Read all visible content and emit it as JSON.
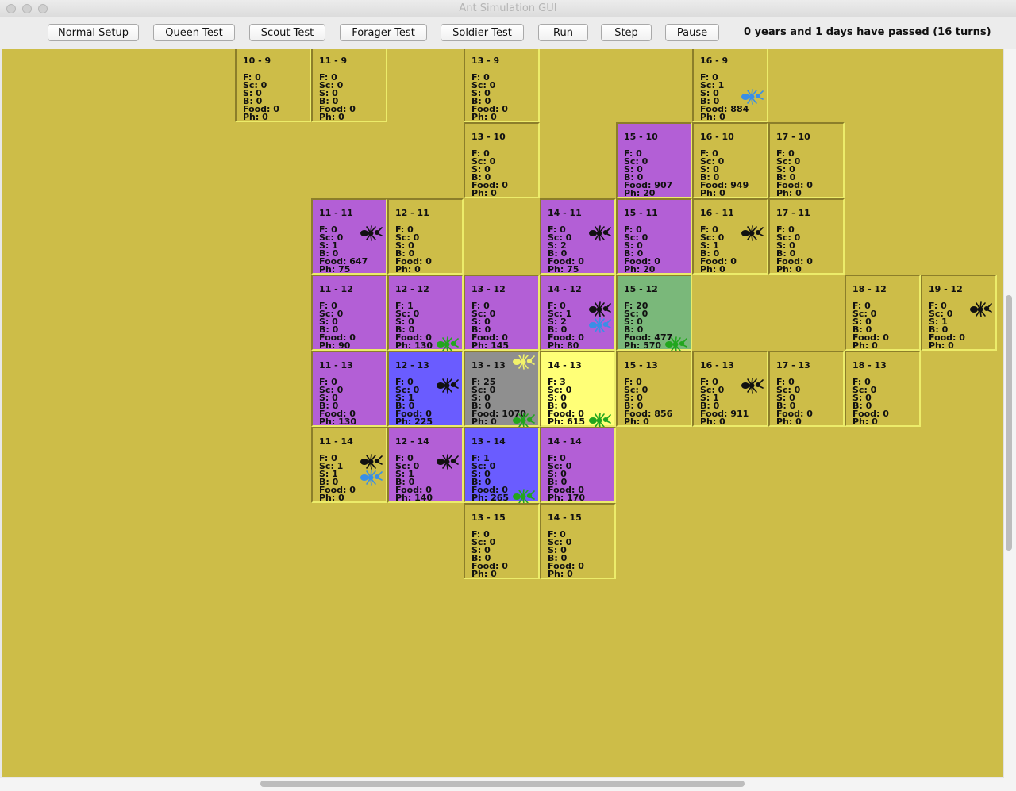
{
  "window": {
    "title": "Ant Simulation GUI"
  },
  "toolbar": {
    "buttons": [
      {
        "id": "normal-setup",
        "label": "Normal Setup"
      },
      {
        "id": "queen-test",
        "label": "Queen Test"
      },
      {
        "id": "scout-test",
        "label": "Scout Test"
      },
      {
        "id": "forager-test",
        "label": "Forager Test"
      },
      {
        "id": "soldier-test",
        "label": "Soldier Test"
      },
      {
        "id": "run",
        "label": "Run"
      },
      {
        "id": "step",
        "label": "Step"
      },
      {
        "id": "pause",
        "label": "Pause"
      }
    ],
    "status": "0 years and 1 days have passed (16 turns)"
  },
  "colors": {
    "board": "#cdbd48",
    "pheromone": "#b35fd6",
    "blue": "#6a5cff",
    "green": "#7ab87a",
    "gray": "#8f8f8f",
    "yellow": "#ffff77",
    "ant_black": "#111111",
    "ant_blue": "#3a8fe6",
    "ant_green": "#22a61e",
    "ant_queen": "#f2f26a"
  },
  "grid": {
    "origin_col": 7,
    "origin_row": 9,
    "cells": [
      {
        "coord": "10 - 9",
        "col": 10,
        "row": 9,
        "color": "visible",
        "F": "0",
        "Sc": "0",
        "S": "0",
        "B": "0",
        "Food": "0",
        "Ph": "0",
        "ants": []
      },
      {
        "coord": "11 - 9",
        "col": 11,
        "row": 9,
        "color": "visible",
        "F": "0",
        "Sc": "0",
        "S": "0",
        "B": "0",
        "Food": "0",
        "Ph": "0",
        "ants": []
      },
      {
        "coord": "13 - 9",
        "col": 13,
        "row": 9,
        "color": "visible",
        "F": "0",
        "Sc": "0",
        "S": "0",
        "B": "0",
        "Food": "0",
        "Ph": "0",
        "ants": []
      },
      {
        "coord": "16 - 9",
        "col": 16,
        "row": 9,
        "color": "visible",
        "F": "0",
        "Sc": "1",
        "S": "0",
        "B": "0",
        "Food": "884",
        "Ph": "0",
        "ants": [
          "blue"
        ]
      },
      {
        "coord": "13 - 10",
        "col": 13,
        "row": 10,
        "color": "visible",
        "F": "0",
        "Sc": "0",
        "S": "0",
        "B": "0",
        "Food": "0",
        "Ph": "0",
        "ants": []
      },
      {
        "coord": "15 - 10",
        "col": 15,
        "row": 10,
        "color": "pheromone",
        "F": "0",
        "Sc": "0",
        "S": "0",
        "B": "0",
        "Food": "907",
        "Ph": "20",
        "ants": []
      },
      {
        "coord": "16 - 10",
        "col": 16,
        "row": 10,
        "color": "visible",
        "F": "0",
        "Sc": "0",
        "S": "0",
        "B": "0",
        "Food": "949",
        "Ph": "0",
        "ants": []
      },
      {
        "coord": "17 - 10",
        "col": 17,
        "row": 10,
        "color": "visible",
        "F": "0",
        "Sc": "0",
        "S": "0",
        "B": "0",
        "Food": "0",
        "Ph": "0",
        "ants": []
      },
      {
        "coord": "11 - 11",
        "col": 11,
        "row": 11,
        "color": "pheromone",
        "F": "0",
        "Sc": "0",
        "S": "1",
        "B": "0",
        "Food": "647",
        "Ph": "75",
        "ants": [
          "black"
        ]
      },
      {
        "coord": "12 - 11",
        "col": 12,
        "row": 11,
        "color": "visible",
        "F": "0",
        "Sc": "0",
        "S": "0",
        "B": "0",
        "Food": "0",
        "Ph": "0",
        "ants": []
      },
      {
        "coord": "14 - 11",
        "col": 14,
        "row": 11,
        "color": "pheromone",
        "F": "0",
        "Sc": "0",
        "S": "2",
        "B": "0",
        "Food": "0",
        "Ph": "75",
        "ants": [
          "black"
        ]
      },
      {
        "coord": "15 - 11",
        "col": 15,
        "row": 11,
        "color": "pheromone",
        "F": "0",
        "Sc": "0",
        "S": "0",
        "B": "0",
        "Food": "0",
        "Ph": "20",
        "ants": []
      },
      {
        "coord": "16 - 11",
        "col": 16,
        "row": 11,
        "color": "visible",
        "F": "0",
        "Sc": "0",
        "S": "1",
        "B": "0",
        "Food": "0",
        "Ph": "0",
        "ants": [
          "black"
        ]
      },
      {
        "coord": "17 - 11",
        "col": 17,
        "row": 11,
        "color": "visible",
        "F": "0",
        "Sc": "0",
        "S": "0",
        "B": "0",
        "Food": "0",
        "Ph": "0",
        "ants": []
      },
      {
        "coord": "11 - 12",
        "col": 11,
        "row": 12,
        "color": "pheromone",
        "F": "0",
        "Sc": "0",
        "S": "0",
        "B": "0",
        "Food": "0",
        "Ph": "90",
        "ants": []
      },
      {
        "coord": "12 - 12",
        "col": 12,
        "row": 12,
        "color": "pheromone",
        "F": "1",
        "Sc": "0",
        "S": "0",
        "B": "0",
        "Food": "0",
        "Ph": "130",
        "ants": [
          "green"
        ]
      },
      {
        "coord": "13 - 12",
        "col": 13,
        "row": 12,
        "color": "pheromone",
        "F": "0",
        "Sc": "0",
        "S": "0",
        "B": "0",
        "Food": "0",
        "Ph": "145",
        "ants": []
      },
      {
        "coord": "14 - 12",
        "col": 14,
        "row": 12,
        "color": "pheromone",
        "F": "0",
        "Sc": "1",
        "S": "2",
        "B": "0",
        "Food": "0",
        "Ph": "80",
        "ants": [
          "black",
          "blue"
        ]
      },
      {
        "coord": "15 - 12",
        "col": 15,
        "row": 12,
        "color": "green",
        "F": "20",
        "Sc": "0",
        "S": "0",
        "B": "0",
        "Food": "477",
        "Ph": "570",
        "ants": [
          "green"
        ]
      },
      {
        "coord": "18 - 12",
        "col": 18,
        "row": 12,
        "color": "visible",
        "F": "0",
        "Sc": "0",
        "S": "0",
        "B": "0",
        "Food": "0",
        "Ph": "0",
        "ants": []
      },
      {
        "coord": "19 - 12",
        "col": 19,
        "row": 12,
        "color": "visible",
        "F": "0",
        "Sc": "0",
        "S": "1",
        "B": "0",
        "Food": "0",
        "Ph": "0",
        "ants": [
          "black"
        ]
      },
      {
        "coord": "11 - 13",
        "col": 11,
        "row": 13,
        "color": "pheromone",
        "F": "0",
        "Sc": "0",
        "S": "0",
        "B": "0",
        "Food": "0",
        "Ph": "130",
        "ants": []
      },
      {
        "coord": "12 - 13",
        "col": 12,
        "row": 13,
        "color": "blue",
        "F": "0",
        "Sc": "0",
        "S": "1",
        "B": "0",
        "Food": "0",
        "Ph": "225",
        "ants": [
          "black"
        ]
      },
      {
        "coord": "13 - 13",
        "col": 13,
        "row": 13,
        "color": "gray",
        "F": "25",
        "Sc": "0",
        "S": "0",
        "B": "0",
        "Food": "1070",
        "Ph": "0",
        "ants": [
          "queen",
          "green"
        ]
      },
      {
        "coord": "14 - 13",
        "col": 14,
        "row": 13,
        "color": "yellow",
        "F": "3",
        "Sc": "0",
        "S": "0",
        "B": "0",
        "Food": "0",
        "Ph": "615",
        "ants": [
          "green"
        ]
      },
      {
        "coord": "15 - 13",
        "col": 15,
        "row": 13,
        "color": "visible",
        "F": "0",
        "Sc": "0",
        "S": "0",
        "B": "0",
        "Food": "856",
        "Ph": "0",
        "ants": []
      },
      {
        "coord": "16 - 13",
        "col": 16,
        "row": 13,
        "color": "visible",
        "F": "0",
        "Sc": "0",
        "S": "1",
        "B": "0",
        "Food": "911",
        "Ph": "0",
        "ants": [
          "black"
        ]
      },
      {
        "coord": "17 - 13",
        "col": 17,
        "row": 13,
        "color": "visible",
        "F": "0",
        "Sc": "0",
        "S": "0",
        "B": "0",
        "Food": "0",
        "Ph": "0",
        "ants": []
      },
      {
        "coord": "18 - 13",
        "col": 18,
        "row": 13,
        "color": "visible",
        "F": "0",
        "Sc": "0",
        "S": "0",
        "B": "0",
        "Food": "0",
        "Ph": "0",
        "ants": []
      },
      {
        "coord": "11 - 14",
        "col": 11,
        "row": 14,
        "color": "visible",
        "F": "0",
        "Sc": "1",
        "S": "1",
        "B": "0",
        "Food": "0",
        "Ph": "0",
        "ants": [
          "black",
          "blue"
        ]
      },
      {
        "coord": "12 - 14",
        "col": 12,
        "row": 14,
        "color": "pheromone",
        "F": "0",
        "Sc": "0",
        "S": "1",
        "B": "0",
        "Food": "0",
        "Ph": "140",
        "ants": [
          "black"
        ]
      },
      {
        "coord": "13 - 14",
        "col": 13,
        "row": 14,
        "color": "blue",
        "F": "1",
        "Sc": "0",
        "S": "0",
        "B": "0",
        "Food": "0",
        "Ph": "265",
        "ants": [
          "green"
        ]
      },
      {
        "coord": "14 - 14",
        "col": 14,
        "row": 14,
        "color": "pheromone",
        "F": "0",
        "Sc": "0",
        "S": "0",
        "B": "0",
        "Food": "0",
        "Ph": "170",
        "ants": []
      },
      {
        "coord": "13 - 15",
        "col": 13,
        "row": 15,
        "color": "visible",
        "F": "0",
        "Sc": "0",
        "S": "0",
        "B": "0",
        "Food": "0",
        "Ph": "0",
        "ants": []
      },
      {
        "coord": "14 - 15",
        "col": 14,
        "row": 15,
        "color": "visible",
        "F": "0",
        "Sc": "0",
        "S": "0",
        "B": "0",
        "Food": "0",
        "Ph": "0",
        "ants": []
      }
    ]
  }
}
